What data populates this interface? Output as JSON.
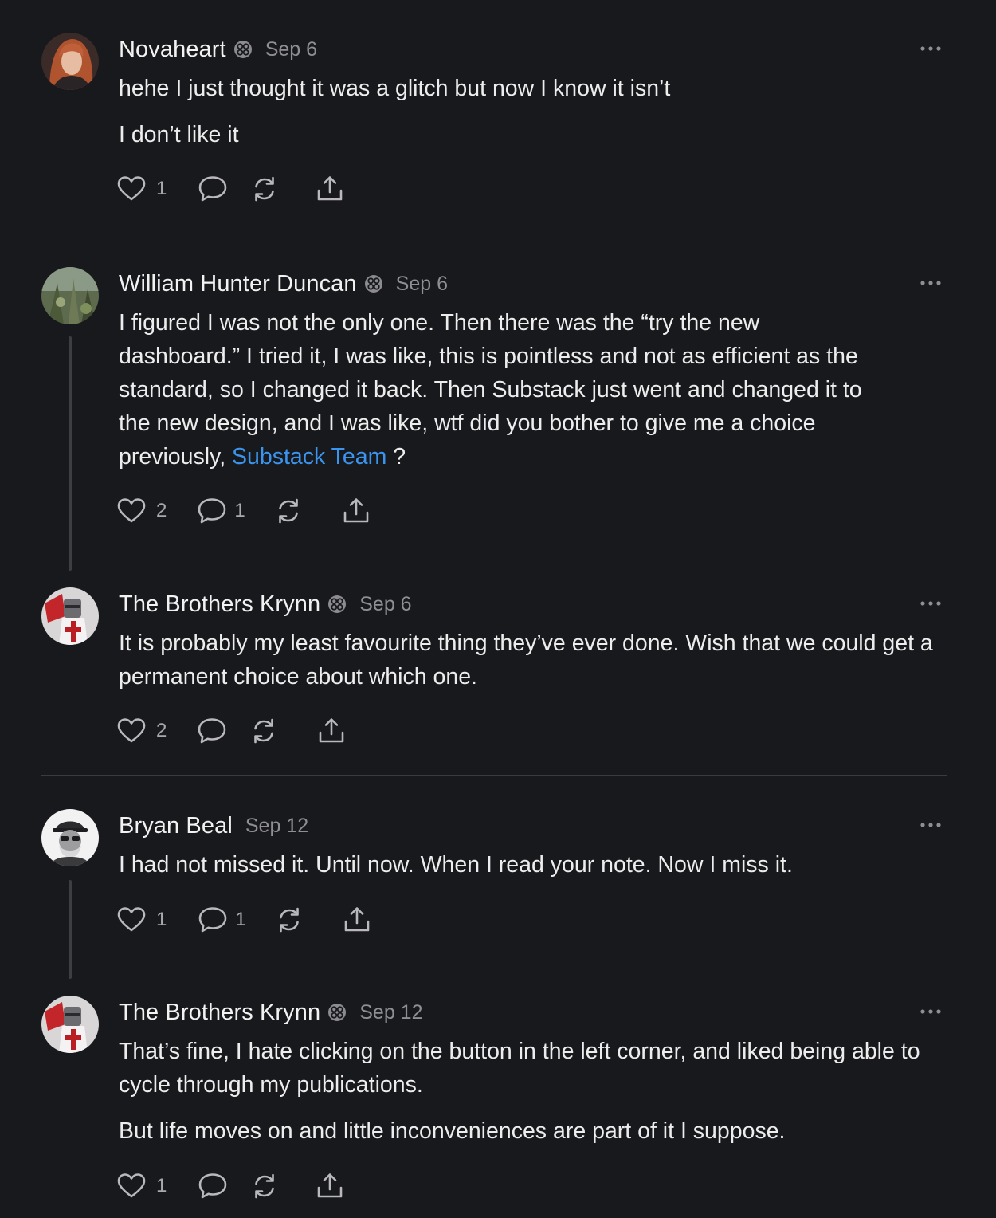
{
  "comments": [
    {
      "author": "Novaheart",
      "date": "Sep 6",
      "paragraphs": [
        "hehe I just thought it was a glitch but now I know it isn’t",
        "I don’t like it"
      ],
      "likes": "1",
      "replies": ""
    },
    {
      "author": "William Hunter Duncan",
      "date": "Sep 6",
      "line1": "I figured I was not the only one. Then there was the “try the new",
      "line2": "dashboard.” I tried it, I was like, this is pointless and not as efficient as the",
      "line3": "standard, so I changed it back. Then Substack just went and changed it to",
      "line4": "the new design, and I was like, wtf did you bother to give me a choice",
      "line5_prefix": "previously,",
      "mention": "Substack Team",
      "line5_suffix": "?",
      "likes": "2",
      "replies": "1"
    },
    {
      "author": "The Brothers Krynn",
      "date": "Sep 6",
      "paragraphs": [
        "It is probably my least favourite thing they’ve ever done. Wish that we could get a permanent choice about which one."
      ],
      "likes": "2",
      "replies": ""
    },
    {
      "author": "Bryan Beal",
      "date": "Sep 12",
      "paragraphs": [
        "I had not missed it. Until now. When I read your note. Now I miss it."
      ],
      "likes": "1",
      "replies": "1"
    },
    {
      "author": "The Brothers Krynn",
      "date": "Sep 12",
      "paragraphs": [
        "That’s fine, I hate clicking on the button in the left corner, and liked being able to cycle through my publications.",
        "But life moves on and little inconveniences are part of it I suppose."
      ],
      "likes": "1",
      "replies": ""
    }
  ],
  "colors": {
    "background": "#18191c",
    "text": "#ececec",
    "muted": "#8e8e93",
    "mention": "#3a95f0",
    "divider": "#3a3b3f"
  },
  "icons": [
    "heart-icon",
    "comment-icon",
    "restack-icon",
    "share-icon",
    "more-icon",
    "verified-badge-icon"
  ]
}
